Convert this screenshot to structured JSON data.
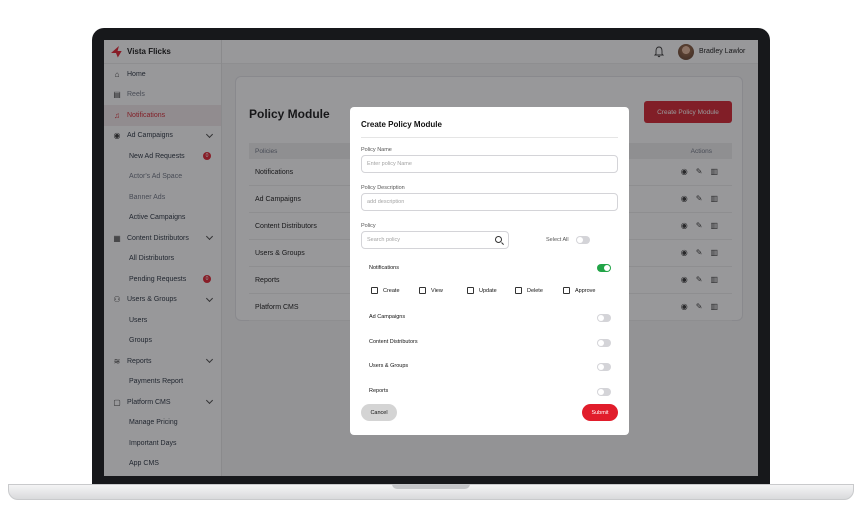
{
  "brand": {
    "name": "Vista Flicks",
    "accent": "#e11d2b"
  },
  "user": {
    "name": "Bradley Lawlor"
  },
  "sidebar": {
    "items": [
      {
        "label": "Home",
        "icon": "home-icon"
      },
      {
        "label": "Reels",
        "icon": "film-icon"
      },
      {
        "label": "Notifications",
        "icon": "bell-icon",
        "active": true
      },
      {
        "label": "Ad Campaigns",
        "icon": "ad-icon"
      },
      {
        "label": "New Ad Requests",
        "badge": "0"
      },
      {
        "label": "Actor's Ad Space"
      },
      {
        "label": "Banner Ads"
      },
      {
        "label": "Active Campaigns"
      },
      {
        "label": "Content Distributors",
        "icon": "building-icon"
      },
      {
        "label": "All Distributors"
      },
      {
        "label": "Pending Requests",
        "badge": "0"
      },
      {
        "label": "Users & Groups",
        "icon": "users-icon"
      },
      {
        "label": "Users"
      },
      {
        "label": "Groups"
      },
      {
        "label": "Reports",
        "icon": "chart-icon"
      },
      {
        "label": "Payments Report"
      },
      {
        "label": "Platform CMS",
        "icon": "cms-icon"
      },
      {
        "label": "Manage Pricing"
      },
      {
        "label": "Important Days"
      },
      {
        "label": "App CMS"
      }
    ]
  },
  "page": {
    "title": "Policy Module",
    "create_button": "Create Policy Module",
    "table": {
      "headers": [
        "Policies",
        "Actions"
      ],
      "rows": [
        "Notifications",
        "Ad Campaigns",
        "Content Distributors",
        "Users & Groups",
        "Reports",
        "Platform CMS"
      ]
    }
  },
  "modal": {
    "title": "Create Policy Module",
    "policy_name_label": "Policy Name",
    "policy_name_placeholder": "Enter policy Name",
    "description_label": "Policy Description",
    "description_placeholder": "add description",
    "policy_label": "Policy",
    "search_placeholder": "Search policy",
    "select_all_label": "Select All",
    "policies": [
      {
        "name": "Notifications",
        "enabled": true
      },
      {
        "name": "Ad Campaigns",
        "enabled": false
      },
      {
        "name": "Content Distributors",
        "enabled": false
      },
      {
        "name": "Users & Groups",
        "enabled": false
      },
      {
        "name": "Reports",
        "enabled": false
      }
    ],
    "permissions": [
      "Create",
      "View",
      "Update",
      "Delete",
      "Approve"
    ],
    "cancel_label": "Cancel",
    "submit_label": "Submit"
  }
}
